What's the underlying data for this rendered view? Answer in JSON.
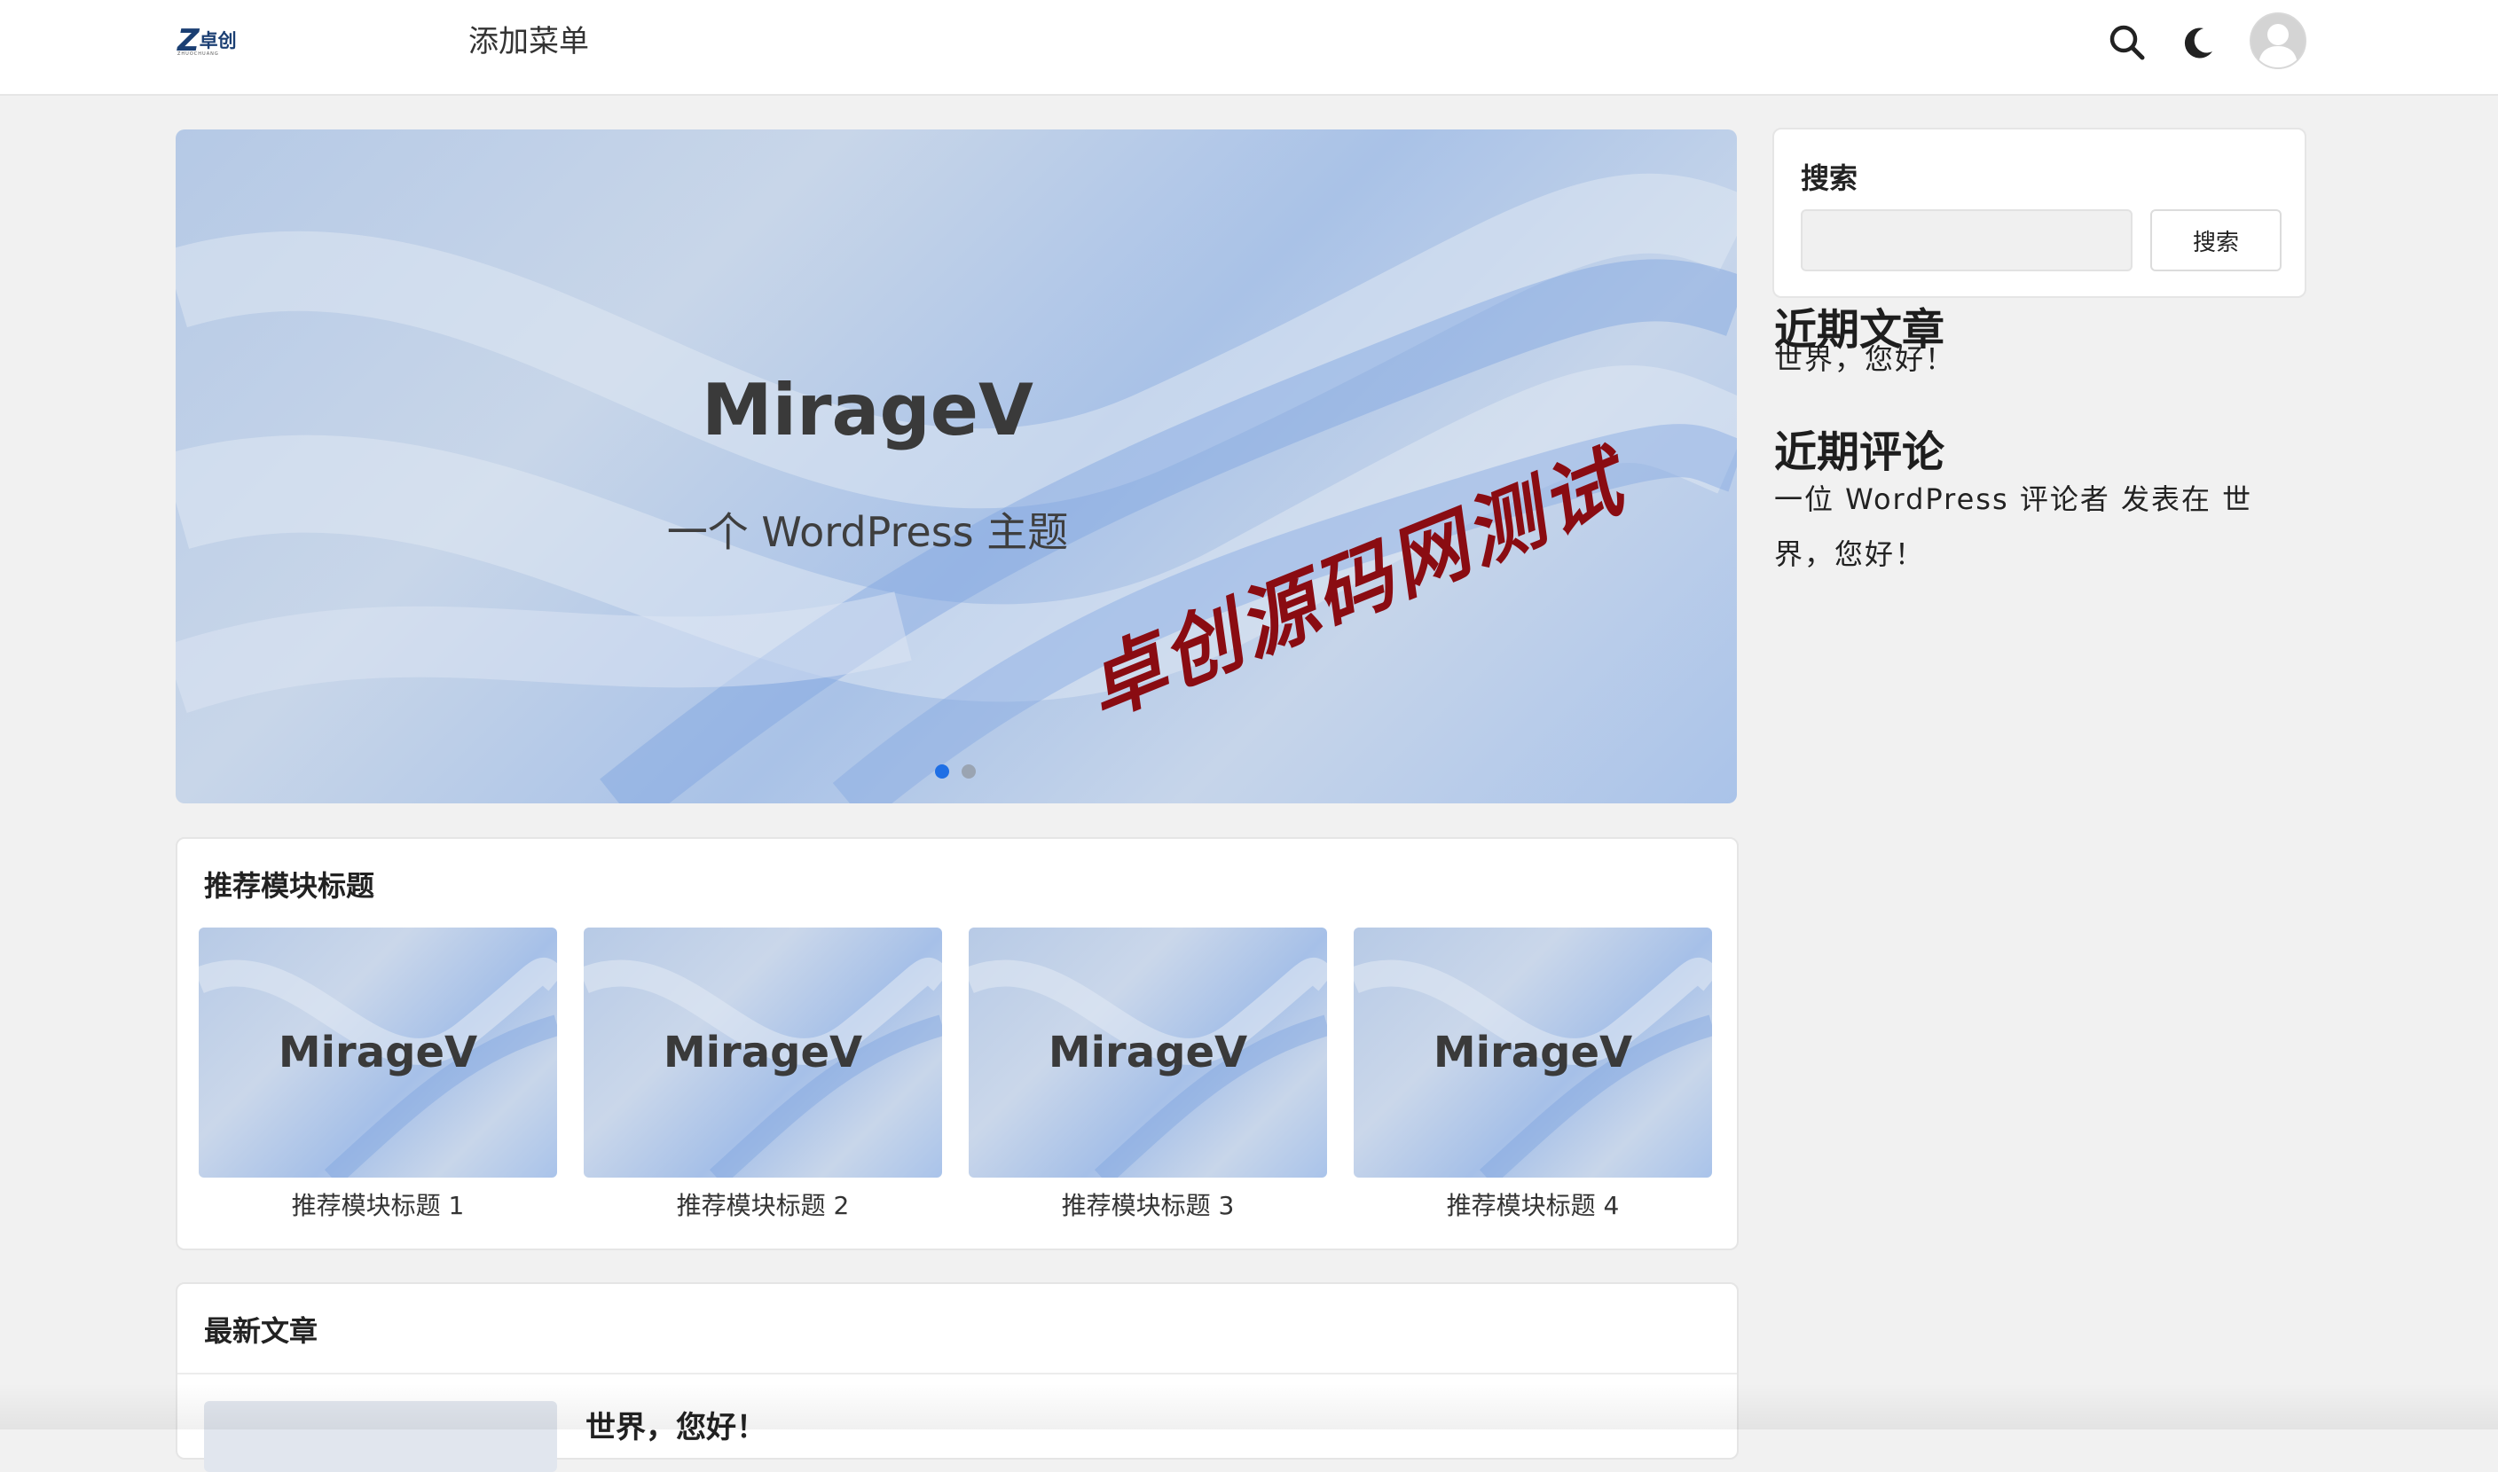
{
  "header": {
    "logo_mark": "Z",
    "logo_text": "卓创",
    "logo_sub": "ZHUOCHUANG",
    "menu_label": "添加菜单",
    "icons": [
      "search-icon",
      "moon-icon",
      "avatar-icon"
    ]
  },
  "hero": {
    "title": "MirageV",
    "subtitle": "一个 WordPress 主题",
    "watermark": "卓创源码网测试",
    "slides": 2,
    "active_slide": 1
  },
  "recommend": {
    "title": "推荐模块标题",
    "items": [
      {
        "image_text": "MirageV",
        "caption": "推荐模块标题 1"
      },
      {
        "image_text": "MirageV",
        "caption": "推荐模块标题 2"
      },
      {
        "image_text": "MirageV",
        "caption": "推荐模块标题 3"
      },
      {
        "image_text": "MirageV",
        "caption": "推荐模块标题 4"
      }
    ]
  },
  "latest": {
    "title": "最新文章",
    "post_title": "世界，您好！"
  },
  "sidebar": {
    "search": {
      "title": "搜索",
      "placeholder": "",
      "button_label": "搜索"
    },
    "recent_posts": {
      "title": "近期文章",
      "items": [
        "世界，您好！"
      ]
    },
    "recent_comments": {
      "title": "近期评论",
      "line1": "一位 WordPress 评论者 发表在 世",
      "line2": "界，您好！"
    }
  },
  "colors": {
    "accent": "#1f6fe5",
    "watermark": "#8a0c12",
    "background": "#f1f1f1",
    "logo": "#1b3f73"
  }
}
